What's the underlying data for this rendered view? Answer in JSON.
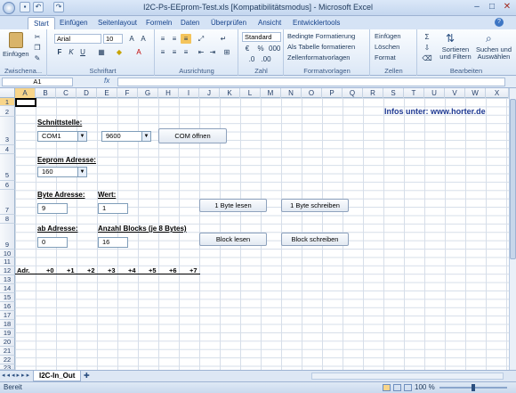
{
  "window": {
    "title": "I2C-Ps-EEprom-Test.xls  [Kompatibilitätsmodus] - Microsoft Excel"
  },
  "tabs": [
    "Start",
    "Einfügen",
    "Seitenlayout",
    "Formeln",
    "Daten",
    "Überprüfen",
    "Ansicht",
    "Entwicklertools"
  ],
  "ribbon": {
    "clipboard": {
      "label": "Zwischena...",
      "paste": "Einfügen"
    },
    "font": {
      "label": "Schriftart",
      "name": "Arial",
      "size": "10"
    },
    "alignment": {
      "label": "Ausrichtung"
    },
    "number": {
      "label": "Zahl",
      "format": "Standard"
    },
    "styles": {
      "label": "Formatvorlagen",
      "items": [
        "Bedingte Formatierung",
        "Als Tabelle formatieren",
        "Zellenformatvorlagen"
      ]
    },
    "cells": {
      "label": "Zellen",
      "items": [
        "Einfügen",
        "Löschen",
        "Format"
      ]
    },
    "editing": {
      "label": "Bearbeiten",
      "sort": "Sortieren und Filtern",
      "find": "Suchen und Auswählen"
    }
  },
  "formula": {
    "namebox": "A1",
    "fx": "fx",
    "content": ""
  },
  "columns": [
    "A",
    "B",
    "C",
    "D",
    "E",
    "F",
    "G",
    "H",
    "I",
    "J",
    "K",
    "L",
    "M",
    "N",
    "O",
    "P",
    "Q",
    "R",
    "S",
    "T",
    "U",
    "V",
    "W",
    "X"
  ],
  "rows": [
    "1",
    "2",
    "3",
    "4",
    "5",
    "6",
    "7",
    "8",
    "9",
    "10",
    "11",
    "12",
    "13",
    "14",
    "15",
    "16",
    "17",
    "18",
    "19",
    "20",
    "21",
    "22",
    "23"
  ],
  "sheet": {
    "info": "Infos unter: www.horter.de",
    "schnittstelle_label": "Schnittstelle:",
    "port_value": "COM1",
    "baud_value": "9600",
    "com_button": "COM öffnen",
    "eeprom_label": "Eeprom Adresse:",
    "eeprom_value": "160",
    "byte_addr_label": "Byte Adresse:",
    "byte_addr_value": "9",
    "wert_label": "Wert:",
    "wert_value": "1",
    "read_byte_button": "1 Byte lesen",
    "write_byte_button": "1 Byte schreiben",
    "ab_addr_label": "ab Adresse:",
    "ab_addr_value": "0",
    "blocks_label": "Anzahl Blocks (je 8 Bytes)",
    "blocks_value": "16",
    "read_block_button": "Block lesen",
    "write_block_button": "Block schreiben",
    "table_header": [
      "Adr.",
      "+0",
      "+1",
      "+2",
      "+3",
      "+4",
      "+5",
      "+6",
      "+7"
    ]
  },
  "sheet_tab": "I2C-In_Out",
  "status": {
    "ready": "Bereit",
    "zoom": "100 %"
  }
}
